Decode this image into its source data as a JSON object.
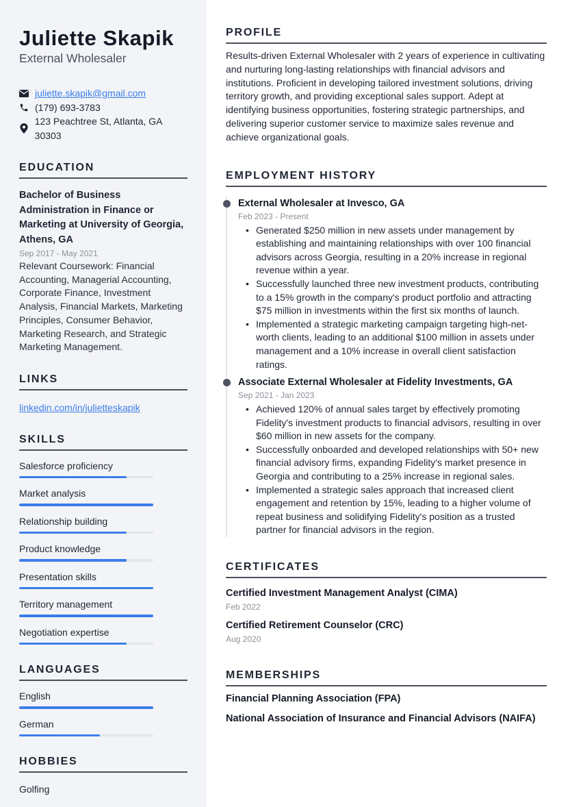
{
  "header": {
    "name": "Juliette Skapik",
    "role": "External Wholesaler"
  },
  "contact": {
    "email": "juliette.skapik@gmail.com",
    "phone": "(179) 693-3783",
    "address": "123 Peachtree St, Atlanta, GA 30303",
    "icons": [
      "envelope-icon",
      "phone-icon",
      "map-pin-icon"
    ]
  },
  "education": {
    "title": "EDUCATION",
    "degree": "Bachelor of Business Administration in Finance or Marketing at University of Georgia, Athens, GA",
    "dates": "Sep 2017 - May 2021",
    "description": "Relevant Coursework: Financial Accounting, Managerial Accounting, Corporate Finance, Investment Analysis, Financial Markets, Marketing Principles, Consumer Behavior, Marketing Research, and Strategic Marketing Management."
  },
  "links": {
    "title": "LINKS",
    "items": [
      "linkedin.com/in/julietteskapik"
    ]
  },
  "skills": {
    "title": "SKILLS",
    "items": [
      {
        "label": "Salesforce proficiency",
        "level": 0.8
      },
      {
        "label": "Market analysis",
        "level": 1.0
      },
      {
        "label": "Relationship building",
        "level": 0.8
      },
      {
        "label": "Product knowledge",
        "level": 0.8
      },
      {
        "label": "Presentation skills",
        "level": 1.0
      },
      {
        "label": "Territory management",
        "level": 1.0
      },
      {
        "label": "Negotiation expertise",
        "level": 0.8
      }
    ]
  },
  "languages": {
    "title": "LANGUAGES",
    "items": [
      {
        "label": "English",
        "level": 1.0
      },
      {
        "label": "German",
        "level": 0.6
      }
    ]
  },
  "hobbies": {
    "title": "HOBBIES",
    "items": [
      "Golfing"
    ]
  },
  "profile": {
    "title": "PROFILE",
    "text": "Results-driven External Wholesaler with 2 years of experience in cultivating and nurturing long-lasting relationships with financial advisors and institutions. Proficient in developing tailored investment solutions, driving territory growth, and providing exceptional sales support. Adept at identifying business opportunities, fostering strategic partnerships, and delivering superior customer service to maximize sales revenue and achieve organizational goals."
  },
  "employment": {
    "title": "EMPLOYMENT HISTORY",
    "jobs": [
      {
        "title": "External Wholesaler at Invesco, GA",
        "dates": "Feb 2023 - Present",
        "bullets": [
          "Generated $250 million in new assets under management by establishing and maintaining relationships with over 100 financial advisors across Georgia, resulting in a 20% increase in regional revenue within a year.",
          "Successfully launched three new investment products, contributing to a 15% growth in the company's product portfolio and attracting $75 million in investments within the first six months of launch.",
          "Implemented a strategic marketing campaign targeting high-net-worth clients, leading to an additional $100 million in assets under management and a 10% increase in overall client satisfaction ratings."
        ]
      },
      {
        "title": "Associate External Wholesaler at Fidelity Investments, GA",
        "dates": "Sep 2021 - Jan 2023",
        "bullets": [
          "Achieved 120% of annual sales target by effectively promoting Fidelity's investment products to financial advisors, resulting in over $60 million in new assets for the company.",
          "Successfully onboarded and developed relationships with 50+ new financial advisory firms, expanding Fidelity's market presence in Georgia and contributing to a 25% increase in regional sales.",
          "Implemented a strategic sales approach that increased client engagement and retention by 15%, leading to a higher volume of repeat business and solidifying Fidelity's position as a trusted partner for financial advisors in the region."
        ]
      }
    ]
  },
  "certificates": {
    "title": "CERTIFICATES",
    "items": [
      {
        "name": "Certified Investment Management Analyst (CIMA)",
        "date": "Feb 2022"
      },
      {
        "name": "Certified Retirement Counselor (CRC)",
        "date": "Aug 2020"
      }
    ]
  },
  "memberships": {
    "title": "MEMBERSHIPS",
    "items": [
      "Financial Planning Association (FPA)",
      "National Association of Insurance and Financial Advisors (NAIFA)"
    ]
  },
  "colors": {
    "accent": "#3b7de8",
    "sidebar_bg": "#f3f4f7",
    "bar_track": "#e3e5ea",
    "timeline_dot": "#4d5361"
  }
}
